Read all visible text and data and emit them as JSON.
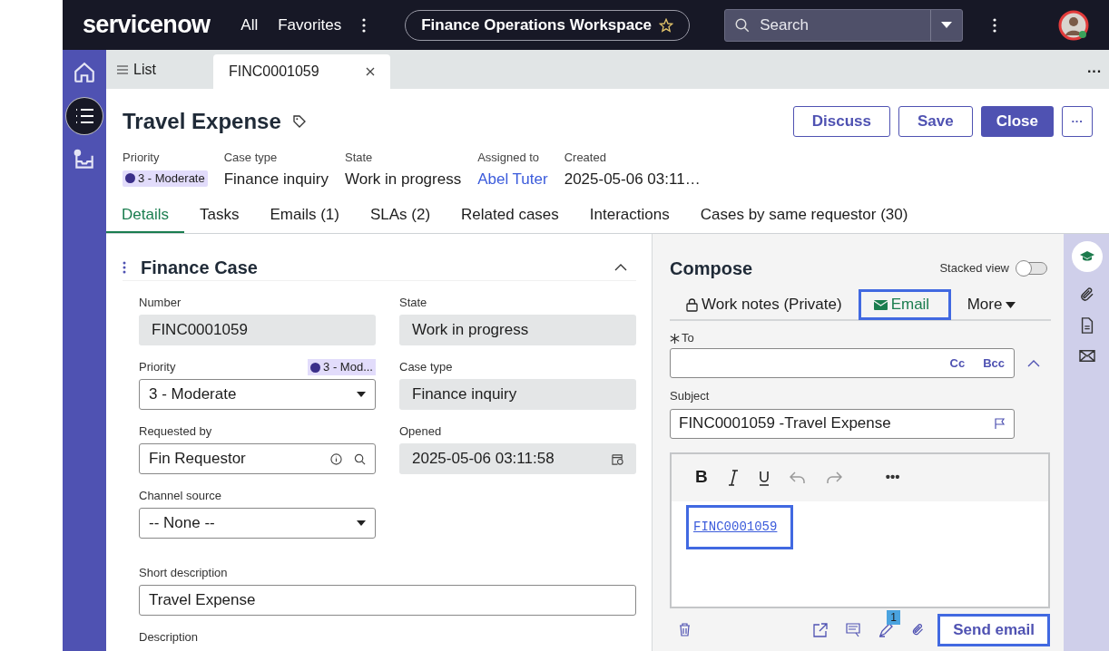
{
  "nav": {
    "logo": "servicenow",
    "links": [
      "All",
      "Favorites"
    ],
    "workspace": "Finance Operations Workspace",
    "search": {
      "placeholder": "Search"
    }
  },
  "tab_menu": "···",
  "tabs": [
    {
      "label": "List",
      "kind": "list",
      "selected": false
    },
    {
      "label": "FINC0001059",
      "kind": "record",
      "selected": true
    }
  ],
  "record": {
    "title": "Travel Expense",
    "meta": [
      {
        "label": "Priority",
        "value": "3 - Moderate",
        "kind": "badge"
      },
      {
        "label": "Case type",
        "value": "Finance inquiry",
        "kind": "text"
      },
      {
        "label": "State",
        "value": "Work in progress",
        "kind": "text"
      },
      {
        "label": "Assigned to",
        "value": "Abel Tuter",
        "kind": "link"
      },
      {
        "label": "Created",
        "value": "2025-05-06 03:11…",
        "kind": "text"
      }
    ],
    "actions": [
      {
        "label": "Discuss",
        "kind": "outline"
      },
      {
        "label": "Save",
        "kind": "outline"
      },
      {
        "label": "Close",
        "kind": "primary"
      },
      {
        "label": "···",
        "kind": "more"
      }
    ],
    "tabs": [
      {
        "label": "Details",
        "selected": true
      },
      {
        "label": "Tasks",
        "selected": false
      },
      {
        "label": "Emails (1)",
        "selected": false
      },
      {
        "label": "SLAs (2)",
        "selected": false
      },
      {
        "label": "Related cases",
        "selected": false
      },
      {
        "label": "Interactions",
        "selected": false
      },
      {
        "label": "Cases by same requestor (30)",
        "selected": false
      }
    ]
  },
  "form": {
    "title": "Finance Case",
    "expanded": true,
    "rows": [
      [
        {
          "label": "Number",
          "value": "FINC0001059",
          "kind": "readonly"
        },
        {
          "label": "State",
          "value": "Work in progress",
          "kind": "readonly"
        }
      ],
      [
        {
          "label": "Priority",
          "value": "3 - Moderate",
          "kind": "select",
          "badge": "3 - Mod..."
        },
        {
          "label": "Case type",
          "value": "Finance inquiry",
          "kind": "readonly"
        }
      ],
      [
        {
          "label": "Requested by",
          "value": "Fin Requestor",
          "kind": "reference"
        },
        {
          "label": "Opened",
          "value": "2025-05-06 03:11:58",
          "kind": "datetime"
        }
      ],
      [
        {
          "label": "Channel source",
          "value": "-- None --",
          "kind": "select"
        }
      ],
      [
        {
          "label": "Short description",
          "value": "Travel Expense",
          "kind": "text"
        }
      ],
      [
        {
          "label": "Description",
          "kind": "label"
        }
      ]
    ]
  },
  "compose": {
    "title": "Compose",
    "stacked_view": {
      "label": "Stacked view",
      "on": false
    },
    "tabs": [
      {
        "label": "Work notes (Private)",
        "kind": "lock",
        "selected": false,
        "highlighted": false
      },
      {
        "label": "Email",
        "kind": "mail",
        "selected": true,
        "highlighted": true
      },
      {
        "label": "More",
        "kind": "menu",
        "selected": false,
        "highlighted": false
      }
    ],
    "to": {
      "label": "To",
      "required": true,
      "links": [
        "Cc",
        "Bcc"
      ]
    },
    "subject": {
      "label": "Subject",
      "value": "FINC0001059 -Travel Expense"
    },
    "editor_toolbar": {
      "bold": "B",
      "more": "•••"
    },
    "body": {
      "link": "FINC0001059",
      "highlighted": true
    },
    "suggestion_count": "1",
    "send": {
      "label": "Send email",
      "highlighted": true
    }
  }
}
